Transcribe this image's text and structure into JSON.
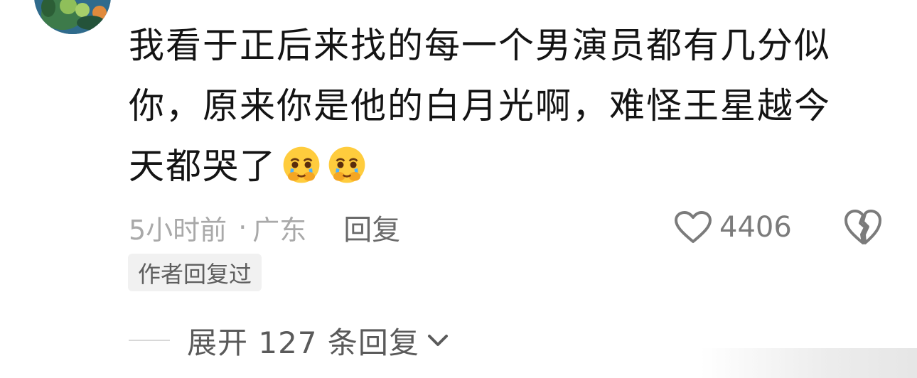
{
  "comment": {
    "text": "我看于正后来找的每一个男演员都有几分似你，原来你是他的白月光啊，难怪王星越今天都哭了",
    "emojis": [
      "crying-pleading-emoji",
      "crying-pleading-emoji"
    ]
  },
  "meta": {
    "time": "5小时前",
    "separator": "·",
    "location": "广东",
    "reply_label": "回复"
  },
  "likes": {
    "count": "4406",
    "like_icon": "heart-outline-icon",
    "dislike_icon": "broken-heart-icon"
  },
  "badge": {
    "label": "作者回复过"
  },
  "expand": {
    "label": "展开 127 条回复",
    "icon": "chevron-down-icon"
  },
  "colors": {
    "text": "#141414",
    "meta": "#a9a9a9",
    "action": "#6a6a6a",
    "badge_bg": "#f1f1f1"
  }
}
